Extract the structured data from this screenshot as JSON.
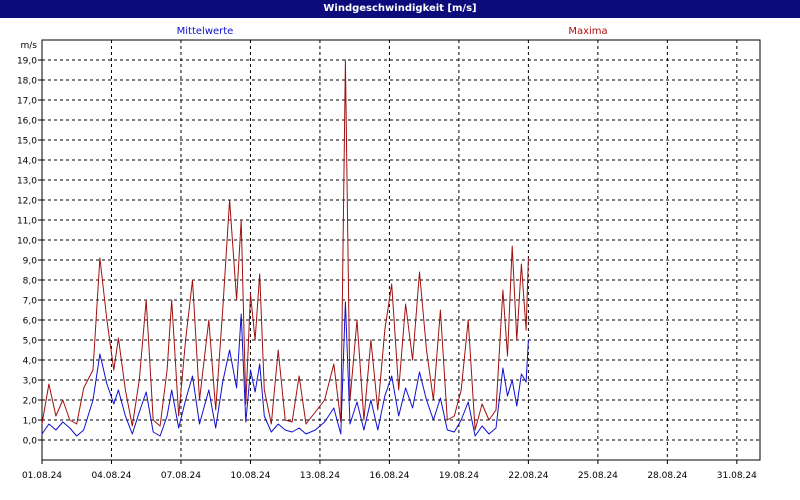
{
  "chart_data": {
    "type": "line",
    "title": "Windgeschwindigkeit [m/s]",
    "ylabel": "m/s",
    "ylim": [
      -1,
      20
    ],
    "yticks": [
      "0,0",
      "1,0",
      "2,0",
      "3,0",
      "4,0",
      "5,0",
      "6,0",
      "7,0",
      "8,0",
      "9,0",
      "10,0",
      "11,0",
      "12,0",
      "13,0",
      "14,0",
      "15,0",
      "16,0",
      "17,0",
      "18,0",
      "19,0"
    ],
    "xticks": [
      "01.08.24",
      "04.08.24",
      "07.08.24",
      "10.08.24",
      "13.08.24",
      "16.08.24",
      "19.08.24",
      "22.08.24",
      "25.08.24",
      "28.08.24",
      "31.08.24"
    ],
    "xlim_days": [
      1,
      32
    ],
    "grid": true,
    "series": [
      {
        "name": "Mittelwerte",
        "color": "#1010d0",
        "x": [
          1.0,
          1.3,
          1.6,
          1.9,
          2.2,
          2.5,
          2.8,
          3.2,
          3.5,
          3.8,
          4.1,
          4.3,
          4.6,
          4.9,
          5.2,
          5.5,
          5.8,
          6.1,
          6.4,
          6.6,
          6.9,
          7.2,
          7.5,
          7.8,
          8.2,
          8.5,
          8.8,
          9.1,
          9.4,
          9.6,
          9.8,
          10.0,
          10.2,
          10.4,
          10.6,
          10.9,
          11.2,
          11.5,
          11.8,
          12.1,
          12.4,
          12.8,
          13.2,
          13.6,
          13.9,
          14.1,
          14.3,
          14.6,
          14.9,
          15.2,
          15.5,
          15.8,
          16.1,
          16.4,
          16.7,
          17.0,
          17.3,
          17.6,
          17.9,
          18.2,
          18.5,
          18.8,
          19.1,
          19.4,
          19.7,
          20.0,
          20.3,
          20.6,
          20.9,
          21.1,
          21.3,
          21.5,
          21.7,
          21.9,
          22.0
        ],
        "y": [
          0.3,
          0.8,
          0.5,
          0.9,
          0.6,
          0.2,
          0.5,
          2.0,
          4.3,
          2.8,
          1.8,
          2.5,
          1.2,
          0.3,
          1.4,
          2.4,
          0.4,
          0.2,
          1.2,
          2.5,
          0.6,
          2.0,
          3.2,
          0.8,
          2.5,
          0.6,
          2.9,
          4.5,
          2.6,
          6.3,
          0.9,
          3.5,
          2.4,
          3.8,
          1.2,
          0.4,
          0.8,
          0.5,
          0.4,
          0.6,
          0.3,
          0.5,
          0.9,
          1.6,
          0.3,
          6.9,
          0.8,
          1.9,
          0.5,
          2.0,
          0.5,
          2.2,
          3.2,
          1.2,
          2.6,
          1.6,
          3.4,
          2.0,
          1.0,
          2.1,
          0.5,
          0.4,
          1.0,
          1.9,
          0.2,
          0.7,
          0.3,
          0.6,
          3.6,
          2.2,
          3.0,
          1.7,
          3.3,
          2.9,
          5.0
        ]
      },
      {
        "name": "Maxima",
        "color": "#a01010",
        "x": [
          1.0,
          1.3,
          1.6,
          1.9,
          2.2,
          2.5,
          2.8,
          3.2,
          3.5,
          3.8,
          4.1,
          4.3,
          4.6,
          4.9,
          5.2,
          5.5,
          5.8,
          6.1,
          6.4,
          6.6,
          6.9,
          7.2,
          7.5,
          7.8,
          8.2,
          8.5,
          8.8,
          9.1,
          9.4,
          9.6,
          9.8,
          10.0,
          10.2,
          10.4,
          10.6,
          10.9,
          11.2,
          11.5,
          11.8,
          12.1,
          12.4,
          12.8,
          13.2,
          13.6,
          13.9,
          14.1,
          14.3,
          14.6,
          14.9,
          15.2,
          15.5,
          15.8,
          16.1,
          16.4,
          16.7,
          17.0,
          17.3,
          17.6,
          17.9,
          18.2,
          18.5,
          18.8,
          19.1,
          19.4,
          19.7,
          20.0,
          20.3,
          20.6,
          20.9,
          21.1,
          21.3,
          21.5,
          21.7,
          21.9,
          22.0
        ],
        "y": [
          0.8,
          2.8,
          1.2,
          2.0,
          1.0,
          0.8,
          2.6,
          3.5,
          9.1,
          6.0,
          3.5,
          5.1,
          2.5,
          0.7,
          3.0,
          7.0,
          1.0,
          0.7,
          3.5,
          7.0,
          1.2,
          5.0,
          8.0,
          2.0,
          6.0,
          1.5,
          6.5,
          12.0,
          7.0,
          11.0,
          1.8,
          7.3,
          5.0,
          8.3,
          2.5,
          0.8,
          4.5,
          1.0,
          0.9,
          3.2,
          0.8,
          1.4,
          2.0,
          3.8,
          0.9,
          19.0,
          2.0,
          6.0,
          1.0,
          5.0,
          1.5,
          5.5,
          7.8,
          2.5,
          6.8,
          4.0,
          8.4,
          4.5,
          2.0,
          6.5,
          1.0,
          1.2,
          2.5,
          6.0,
          0.5,
          1.8,
          1.0,
          1.5,
          7.5,
          4.2,
          9.7,
          5.0,
          8.8,
          5.5,
          9.1
        ]
      }
    ]
  }
}
